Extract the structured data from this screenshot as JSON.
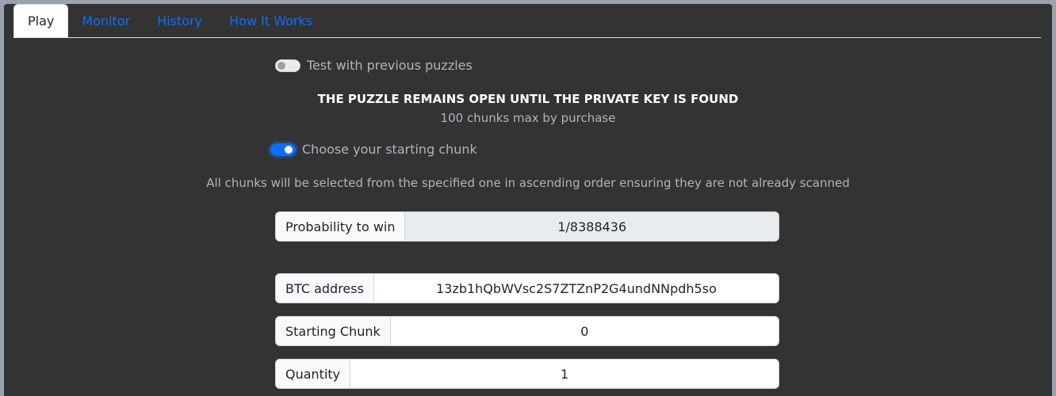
{
  "tabs": [
    {
      "label": "Play",
      "active": true
    },
    {
      "label": "Monitor",
      "active": false
    },
    {
      "label": "History",
      "active": false
    },
    {
      "label": "How It Works",
      "active": false
    }
  ],
  "test_toggle": {
    "label": "Test with previous puzzles",
    "checked": false
  },
  "headline": "THE PUZZLE REMAINS OPEN UNTIL THE PRIVATE KEY IS FOUND",
  "subline": "100 chunks max by purchase",
  "start_toggle": {
    "label": "Choose your starting chunk",
    "checked": true
  },
  "note": "All chunks will be selected from the specified one in ascending order ensuring they are not already scanned",
  "fields": {
    "probability": {
      "label": "Probability to win",
      "value": "1/8388436"
    },
    "btc_address": {
      "label": "BTC address",
      "value": "13zb1hQbWVsc2S7ZTZnP2G4undNNpdh5so"
    },
    "starting_chunk": {
      "label": "Starting Chunk",
      "value": "0"
    },
    "quantity": {
      "label": "Quantity",
      "value": "1"
    }
  },
  "colors": {
    "accent": "#0d6efd",
    "background": "#333333"
  }
}
